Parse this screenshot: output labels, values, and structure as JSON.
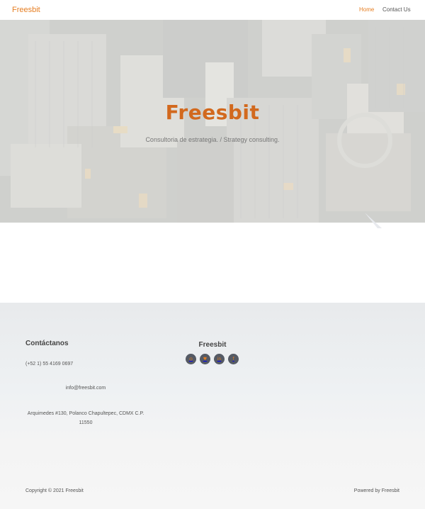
{
  "navbar": {
    "brand": "Freesbit",
    "links": [
      {
        "label": "Home",
        "active": true
      },
      {
        "label": "Contact Us",
        "active": false
      }
    ],
    "accent_color": "#e67e22"
  },
  "hero": {
    "title": "Freesbit",
    "subtitle": "Consultoria de estrategia. / Strategy consulting.",
    "background": "aerial-city-photo"
  },
  "footer": {
    "contact_heading": "Contáctanos",
    "phone": "(+52 1) 55 4169 0697",
    "email": "info@freesbit.com",
    "address": "Arquimedes #130, Polanco Chapultepec, CDMX C.P. 11550",
    "brand": "Freesbit",
    "socials": [
      {
        "name": "instagram-icon",
        "glyph": "◎"
      },
      {
        "name": "twitter-icon",
        "glyph": "♥"
      },
      {
        "name": "linkedin-icon",
        "glyph": "in"
      },
      {
        "name": "facebook-icon",
        "glyph": "f"
      }
    ],
    "copyright": "Copyright © 2021 Freesbit",
    "powered": "Powered by Freesbit"
  }
}
